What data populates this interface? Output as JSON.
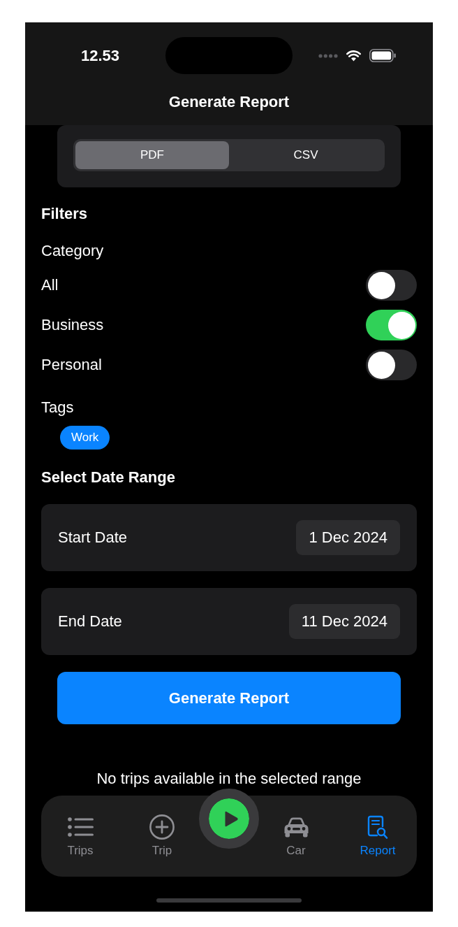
{
  "status_bar": {
    "time": "12.53"
  },
  "navigation_bar": {
    "title": "Generate Report"
  },
  "format": {
    "options": [
      {
        "label": "PDF",
        "selected": true
      },
      {
        "label": "CSV",
        "selected": false
      }
    ]
  },
  "filters": {
    "title": "Filters",
    "category_label": "Category",
    "categories": [
      {
        "label": "All",
        "on": false
      },
      {
        "label": "Business",
        "on": true
      },
      {
        "label": "Personal",
        "on": false
      }
    ],
    "tags_label": "Tags",
    "tags": [
      {
        "label": "Work"
      }
    ]
  },
  "date_range": {
    "title": "Select Date Range",
    "fields": [
      {
        "label": "Start Date",
        "value": "1 Dec 2024"
      },
      {
        "label": "End Date",
        "value": "11 Dec 2024"
      }
    ]
  },
  "generate_button": {
    "label": "Generate Report"
  },
  "empty_message": "No trips available in the selected range",
  "tab_bar": {
    "tabs": [
      {
        "label": "Trips",
        "selected": false
      },
      {
        "label": "Trip",
        "selected": false
      },
      {
        "label": "Car",
        "selected": false
      },
      {
        "label": "Report",
        "selected": true
      }
    ]
  }
}
